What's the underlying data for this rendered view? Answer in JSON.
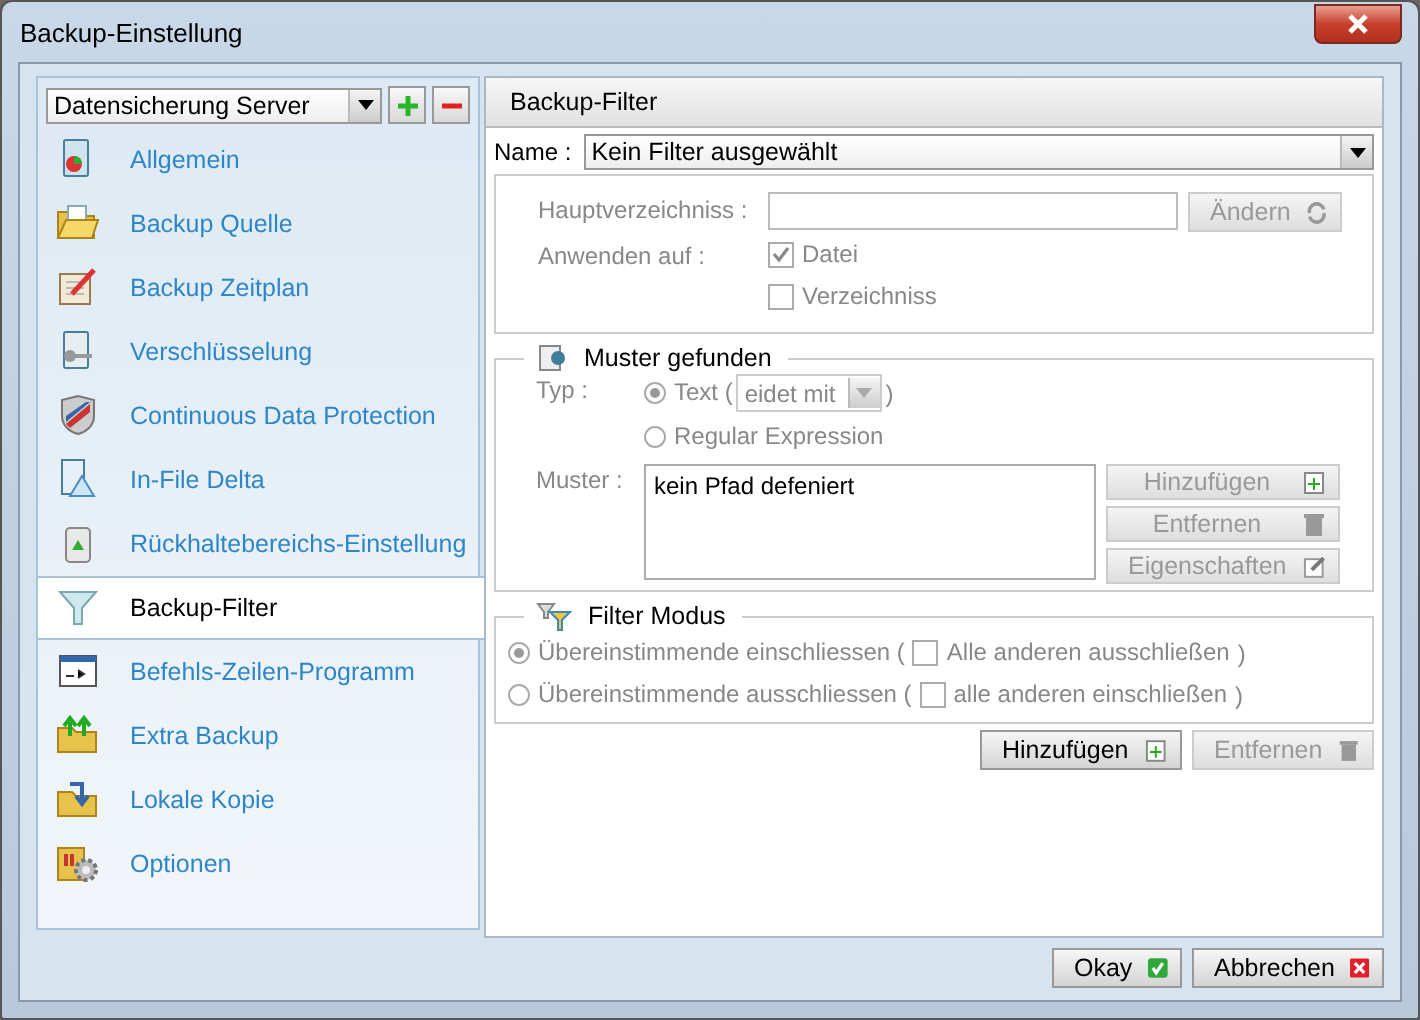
{
  "window": {
    "title": "Backup-Einstellung"
  },
  "profile": {
    "value": "Datensicherung Server"
  },
  "sidebar": {
    "items": [
      {
        "label": "Allgemein",
        "selected": false
      },
      {
        "label": "Backup Quelle",
        "selected": false
      },
      {
        "label": "Backup Zeitplan",
        "selected": false
      },
      {
        "label": "Verschlüsselung",
        "selected": false
      },
      {
        "label": "Continuous Data Protection",
        "selected": false
      },
      {
        "label": "In-File Delta",
        "selected": false
      },
      {
        "label": "Rückhaltebereichs-Einstellung",
        "selected": false
      },
      {
        "label": "Backup-Filter",
        "selected": true
      },
      {
        "label": "Befehls-Zeilen-Programm",
        "selected": false
      },
      {
        "label": "Extra Backup",
        "selected": false
      },
      {
        "label": "Lokale Kopie",
        "selected": false
      },
      {
        "label": "Optionen",
        "selected": false
      }
    ]
  },
  "panel": {
    "title": "Backup-Filter"
  },
  "name_field": {
    "label": "Name :",
    "value": "Kein Filter ausgewählt"
  },
  "root": {
    "label": "Hauptverzeichniss :",
    "button": "Ändern",
    "disabled": true
  },
  "apply": {
    "label": "Anwenden auf :",
    "options": [
      {
        "label": "Datei",
        "checked": true
      },
      {
        "label": "Verzeichniss",
        "checked": false
      }
    ]
  },
  "pattern_group": {
    "title": "Muster gefunden",
    "type_label": "Typ :",
    "types": [
      {
        "label": "Text (",
        "selected": true,
        "combo": "eidet mit",
        "close": ")"
      },
      {
        "label": "Regular Expression",
        "selected": false
      }
    ],
    "pattern_label": "Muster :",
    "pattern_text": "kein Pfad defeniert",
    "buttons": [
      {
        "label": "Hinzufügen",
        "kind": "add",
        "disabled": true
      },
      {
        "label": "Entfernen",
        "kind": "remove",
        "disabled": true
      },
      {
        "label": "Eigenschaften",
        "kind": "edit",
        "disabled": true
      }
    ]
  },
  "mode_group": {
    "title": "Filter Modus",
    "options": [
      {
        "label": "Übereinstimmende einschliessen (",
        "selected": true,
        "check_label": "Alle anderen ausschließen",
        "checked": false,
        "close": ")"
      },
      {
        "label": "Übereinstimmende ausschliessen (",
        "selected": false,
        "check_label": "alle anderen einschließen",
        "checked": false,
        "close": ")"
      }
    ]
  },
  "actions": [
    {
      "label": "Hinzufügen",
      "kind": "add",
      "disabled": false
    },
    {
      "label": "Entfernen",
      "kind": "remove",
      "disabled": true
    }
  ],
  "footer": [
    {
      "label": "Okay",
      "kind": "ok"
    },
    {
      "label": "Abbrechen",
      "kind": "cancel"
    }
  ]
}
